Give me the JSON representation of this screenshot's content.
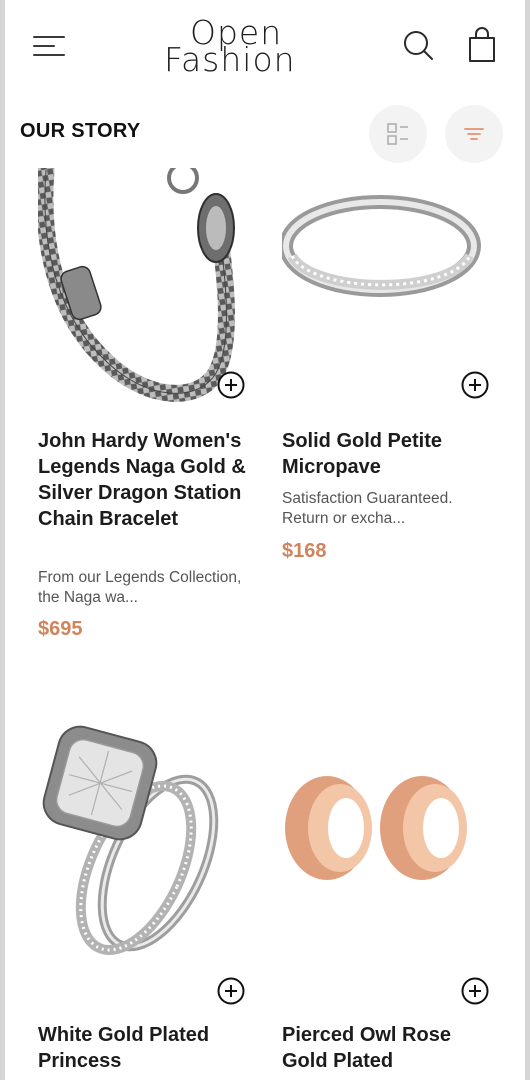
{
  "header": {
    "logo_line1": "Open",
    "logo_line2": "Fashion"
  },
  "section": {
    "title": "OUR STORY"
  },
  "products": [
    {
      "name": "John Hardy Women's Legends Naga Gold & Silver Dragon Station Chain Bracelet",
      "description": "From our Legends Collection, the Naga wa...",
      "price": "$695"
    },
    {
      "name": "Solid Gold Petite Micropave",
      "description": "Satisfaction Guaranteed. Return or excha...",
      "price": "$168"
    },
    {
      "name": "White Gold Plated Princess",
      "description": "",
      "price": ""
    },
    {
      "name": "Pierced Owl Rose Gold Plated",
      "description": "",
      "price": ""
    }
  ],
  "colors": {
    "price": "#d1845c",
    "accent_filter": "#e88f6e",
    "text": "#1c1c1c"
  },
  "icons": [
    "menu-icon",
    "search-icon",
    "shopping-bag-icon",
    "list-view-icon",
    "filter-icon",
    "add-circle-icon"
  ]
}
